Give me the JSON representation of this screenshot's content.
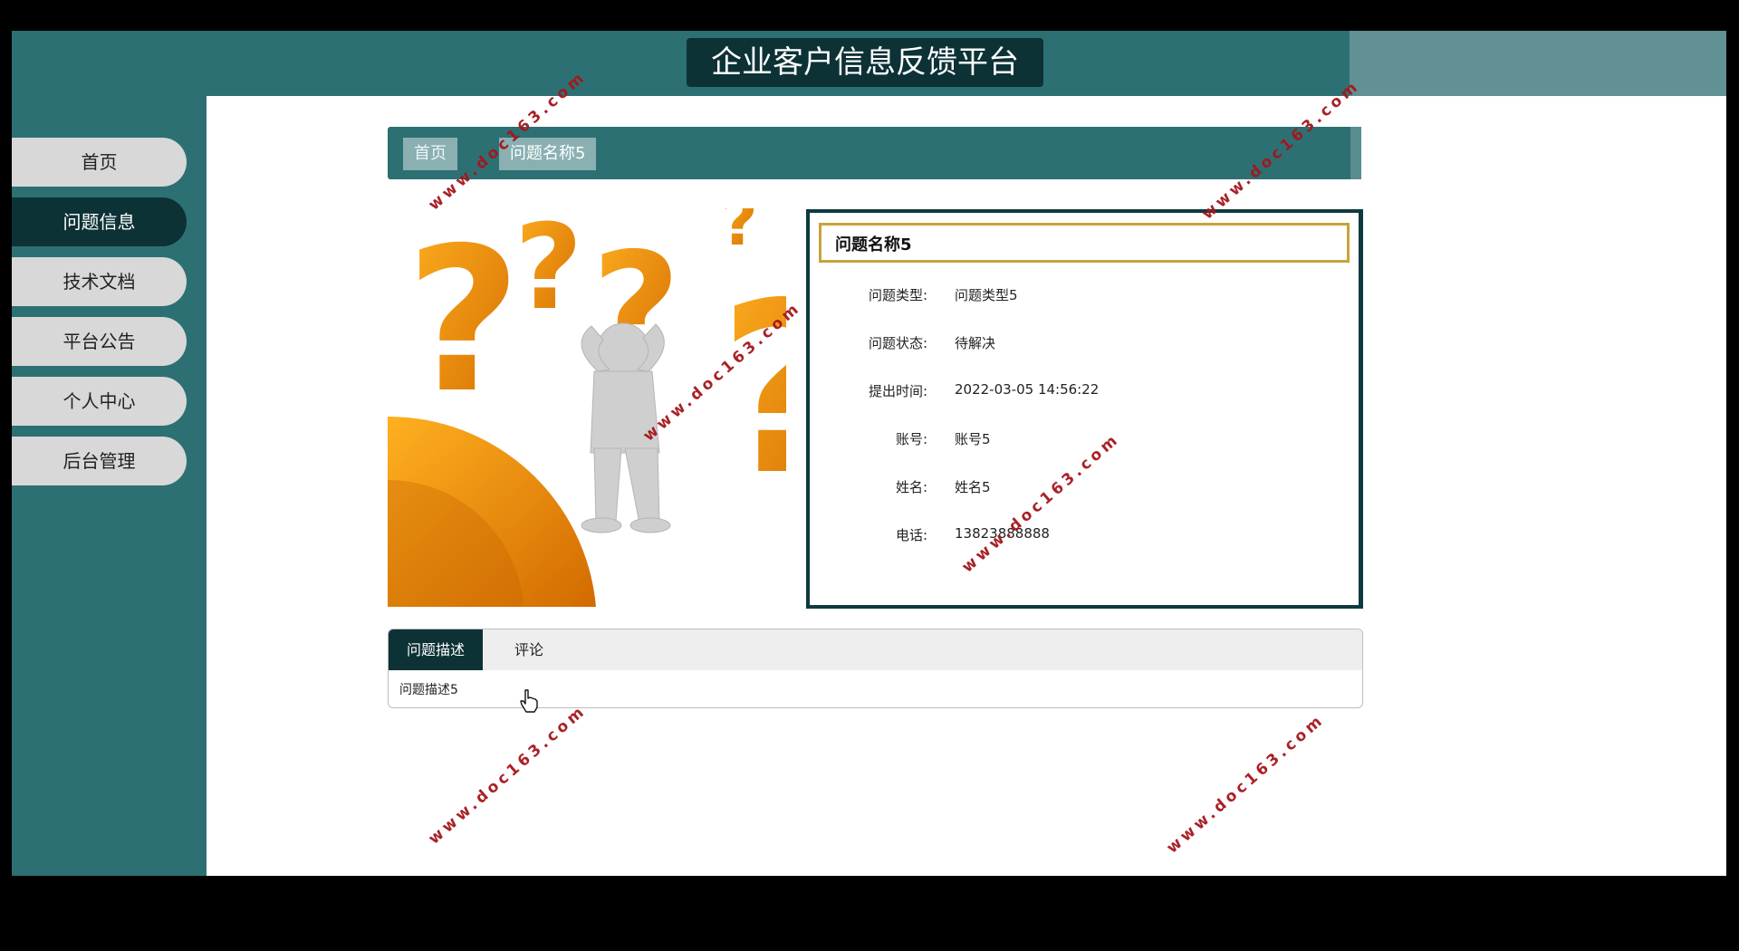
{
  "header": {
    "title": "企业客户信息反馈平台"
  },
  "sidebar": {
    "items": [
      {
        "label": "首页"
      },
      {
        "label": "问题信息"
      },
      {
        "label": "技术文档"
      },
      {
        "label": "平台公告"
      },
      {
        "label": "个人中心"
      },
      {
        "label": "后台管理"
      }
    ],
    "active": "问题信息"
  },
  "breadcrumb": {
    "home": "首页",
    "current": "问题名称5"
  },
  "detail": {
    "title": "问题名称5",
    "fields": [
      {
        "label": "问题类型:",
        "value": "问题类型5"
      },
      {
        "label": "问题状态:",
        "value": "待解决"
      },
      {
        "label": "提出时间:",
        "value": "2022-03-05 14:56:22"
      },
      {
        "label": "账号:",
        "value": "账号5"
      },
      {
        "label": "姓名:",
        "value": "姓名5"
      },
      {
        "label": "电话:",
        "value": "13823888888"
      }
    ]
  },
  "tabs": {
    "items": [
      {
        "label": "问题描述"
      },
      {
        "label": "评论"
      }
    ],
    "active_content": "问题描述5"
  },
  "watermark": {
    "text": "www.doc163.com"
  },
  "colors": {
    "primary": "#2d7073",
    "dark": "#0c3236",
    "accent_border": "#c7a33a",
    "watermark": "#a5161b"
  }
}
